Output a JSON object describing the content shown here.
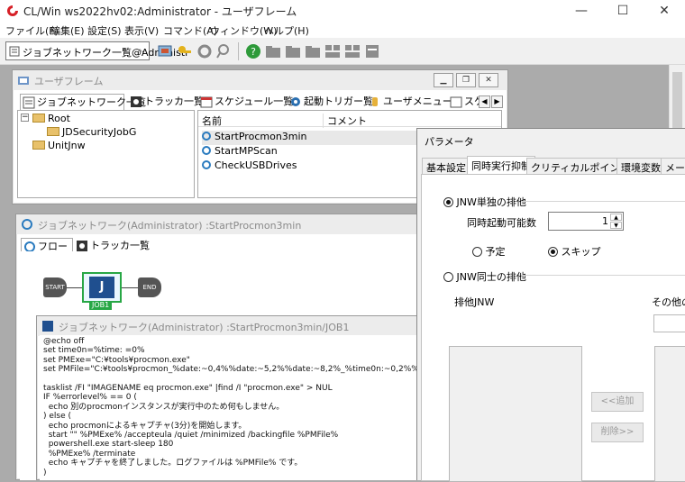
{
  "window": {
    "title": "CL/Win ws2022hv02:Administrator - ユーザフレーム",
    "minimize": "—",
    "maximize": "☐",
    "close": "✕"
  },
  "menu": [
    "ファイル(F)",
    "編集(E)",
    "設定(S)",
    "表示(V)",
    "コマンド(A)",
    "ウィンドウ(W)",
    "ヘルプ(H)"
  ],
  "toolbar": {
    "selector_value": "ジョブネットワーク一覧@Administı"
  },
  "frame": {
    "title": "ユーザフレーム",
    "tabs": [
      "ジョブネットワーク一覧",
      "トラッカ一覧",
      "スケジュール一覧",
      "起動トリガー覧",
      "ユーザメニュー",
      "スケ"
    ],
    "tree": {
      "root": "Root",
      "child": "JDSecurityJobG",
      "sibling": "UnitJnw"
    },
    "list": {
      "columns": [
        "名前",
        "コメント"
      ],
      "rows": [
        "StartProcmon3min",
        "StartMPScan",
        "CheckUSBDrives"
      ]
    }
  },
  "jnw": {
    "title": "ジョブネットワーク(Administrator) :StartProcmon3min",
    "tabs": [
      "フロー",
      "トラッカ一覧"
    ],
    "flow": {
      "start": "START",
      "end": "END",
      "job_icon": "J",
      "job_label": "JOB1"
    }
  },
  "jobwin": {
    "title": "ジョブネットワーク(Administrator) :StartProcmon3min/JOB1",
    "script": "@echo off\nset time0n=%time: =0%\nset PMExe=\"C:¥tools¥procmon.exe\"\nset PMFile=\"C:¥tools¥procmon_%date:~0,4%%date:~5,2%%date:~8,2%_%time0n:~0,2%%time0n:~3,2%.pml\"\n\ntasklist /FI \"IMAGENAME eq procmon.exe\" |find /I \"procmon.exe\" > NUL\nIF %errorlevel% == 0 (\n  echo 別のprocmonインスタンスが実行中のため何もしません。\n) else (\n  echo procmonによるキャプチャ(3分)を開始します。\n  start \"\" %PMExe% /accepteula /quiet /minimized /backingfile %PMFile%\n  powershell.exe start-sleep 180\n  %PMExe% /terminate\n  echo キャプチャを終了しました。ログファイルは %PMFile% です。\n)"
  },
  "param": {
    "title": "パラメータ",
    "tabs": [
      "基本設定",
      "同時実行抑制",
      "クリティカルポイント警告",
      "環境変数",
      "メール通"
    ],
    "jnw_exclusive": "JNW単独の排他",
    "concurrent_label": "同時起動可能数",
    "concurrent_value": "1",
    "option_reserve": "予定",
    "option_skip": "スキップ",
    "jnw_mutual": "JNW同士の排他",
    "exclusive_list_label": "排他JNW",
    "other_label": "その他のJ",
    "add_button": "<<追加",
    "remove_button": "削除>>"
  }
}
